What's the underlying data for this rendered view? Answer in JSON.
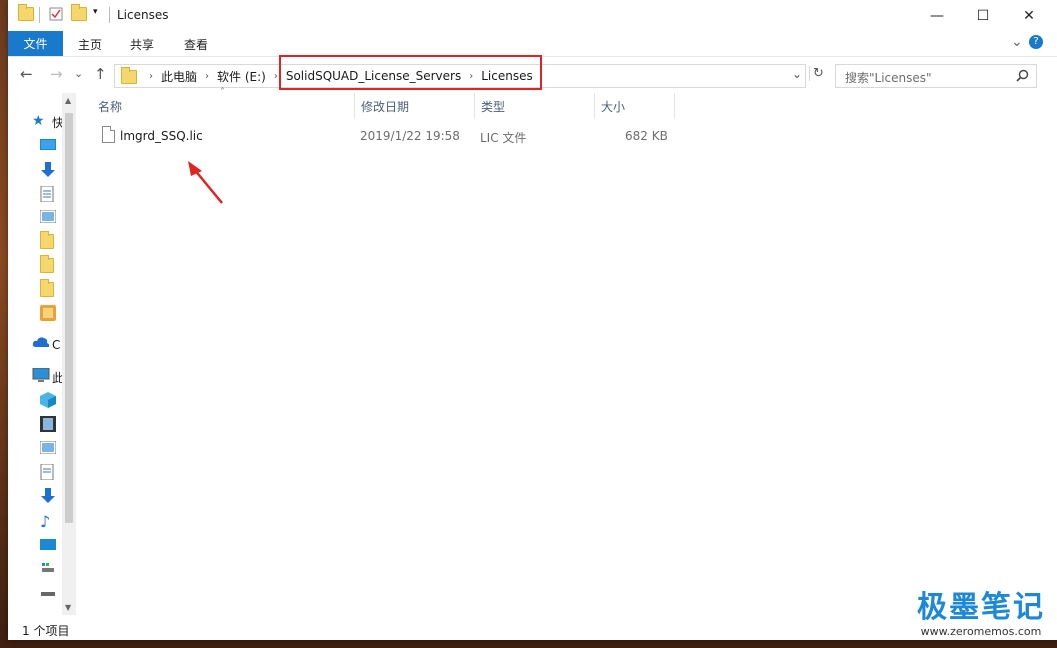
{
  "window": {
    "title": "Licenses",
    "minimize_glyph": "—",
    "maximize_glyph": "☐",
    "close_glyph": "✕"
  },
  "ribbon": {
    "tabs": [
      "文件",
      "主页",
      "共享",
      "查看"
    ],
    "expand_glyph": "⌄",
    "help_glyph": "?"
  },
  "address": {
    "crumbs": [
      "此电脑",
      "软件 (E:)",
      "SolidSQUAD_License_Servers",
      "Licenses"
    ],
    "back_glyph": "←",
    "forward_glyph": "→",
    "recent_glyph": "⌄",
    "up_glyph": "↑",
    "dropdown_glyph": "⌄",
    "refresh_glyph": "↻"
  },
  "search": {
    "placeholder": "搜索\"Licenses\"",
    "icon": "search-icon"
  },
  "columns": {
    "name": "名称",
    "date": "修改日期",
    "type": "类型",
    "size": "大小"
  },
  "files": [
    {
      "name": "lmgrd_SSQ.lic",
      "date": "2019/1/22 19:58",
      "type": "LIC 文件",
      "size": "682 KB"
    }
  ],
  "nav": {
    "labels": [
      "快",
      "C",
      "此"
    ]
  },
  "status": {
    "item_count": "1 个项目"
  },
  "watermark": {
    "brand": "极墨笔记",
    "url": "www.zeromemos.com"
  },
  "colors": {
    "accent": "#1979ca",
    "highlight": "#e02424",
    "folder": "#f5d76e"
  }
}
